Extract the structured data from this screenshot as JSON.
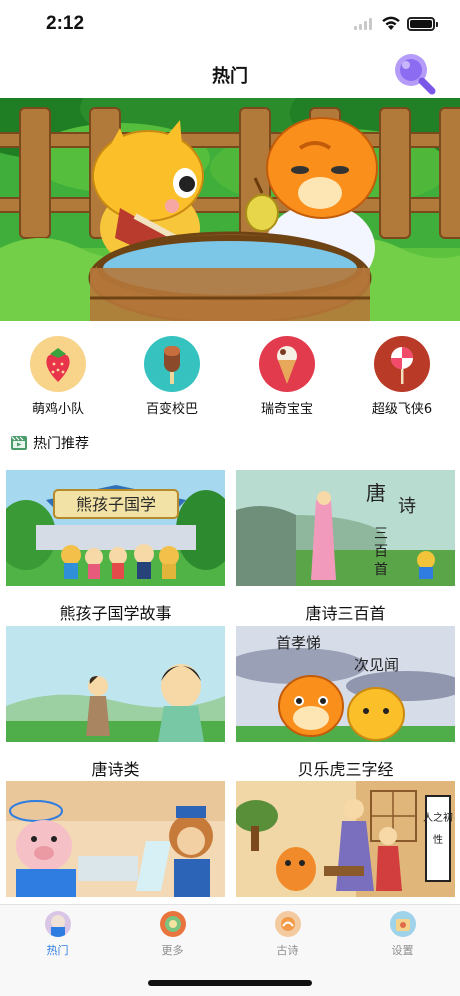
{
  "status_bar": {
    "time": "2:12"
  },
  "nav": {
    "title": "热门"
  },
  "categories": [
    {
      "label": "萌鸡小队",
      "icon": "strawberry-icon",
      "color": "#f8d38a"
    },
    {
      "label": "百变校巴",
      "icon": "popsicle-icon",
      "color": "#36c3c0"
    },
    {
      "label": "瑞奇宝宝",
      "icon": "ice-cream-icon",
      "color": "#e23b4e"
    },
    {
      "label": "超级飞侠6",
      "icon": "lollipop-icon",
      "color": "#b93a26"
    }
  ],
  "section": {
    "title": "热门推荐",
    "icon": "video-clapper-icon"
  },
  "cards": [
    {
      "title": "熊孩子国学故事",
      "banner_text": "熊孩子国学"
    },
    {
      "title": "唐诗三百首",
      "poem_text_1": "唐",
      "poem_text_2": "诗",
      "poem_text_3": "三",
      "poem_text_4": "百",
      "poem_text_5": "首"
    },
    {
      "title": "唐诗类"
    },
    {
      "title": "贝乐虎三字经",
      "text_1": "首孝悌",
      "text_2": "次见闻"
    },
    {
      "title": ""
    },
    {
      "title": "",
      "scroll_text_1": "人之初",
      "scroll_text_2": "性"
    }
  ],
  "tabs": [
    {
      "label": "热门",
      "active": true
    },
    {
      "label": "更多",
      "active": false
    },
    {
      "label": "古诗",
      "active": false
    },
    {
      "label": "设置",
      "active": false
    }
  ],
  "colors": {
    "accent": "#2f7de1",
    "search": "#8c6cf0"
  }
}
